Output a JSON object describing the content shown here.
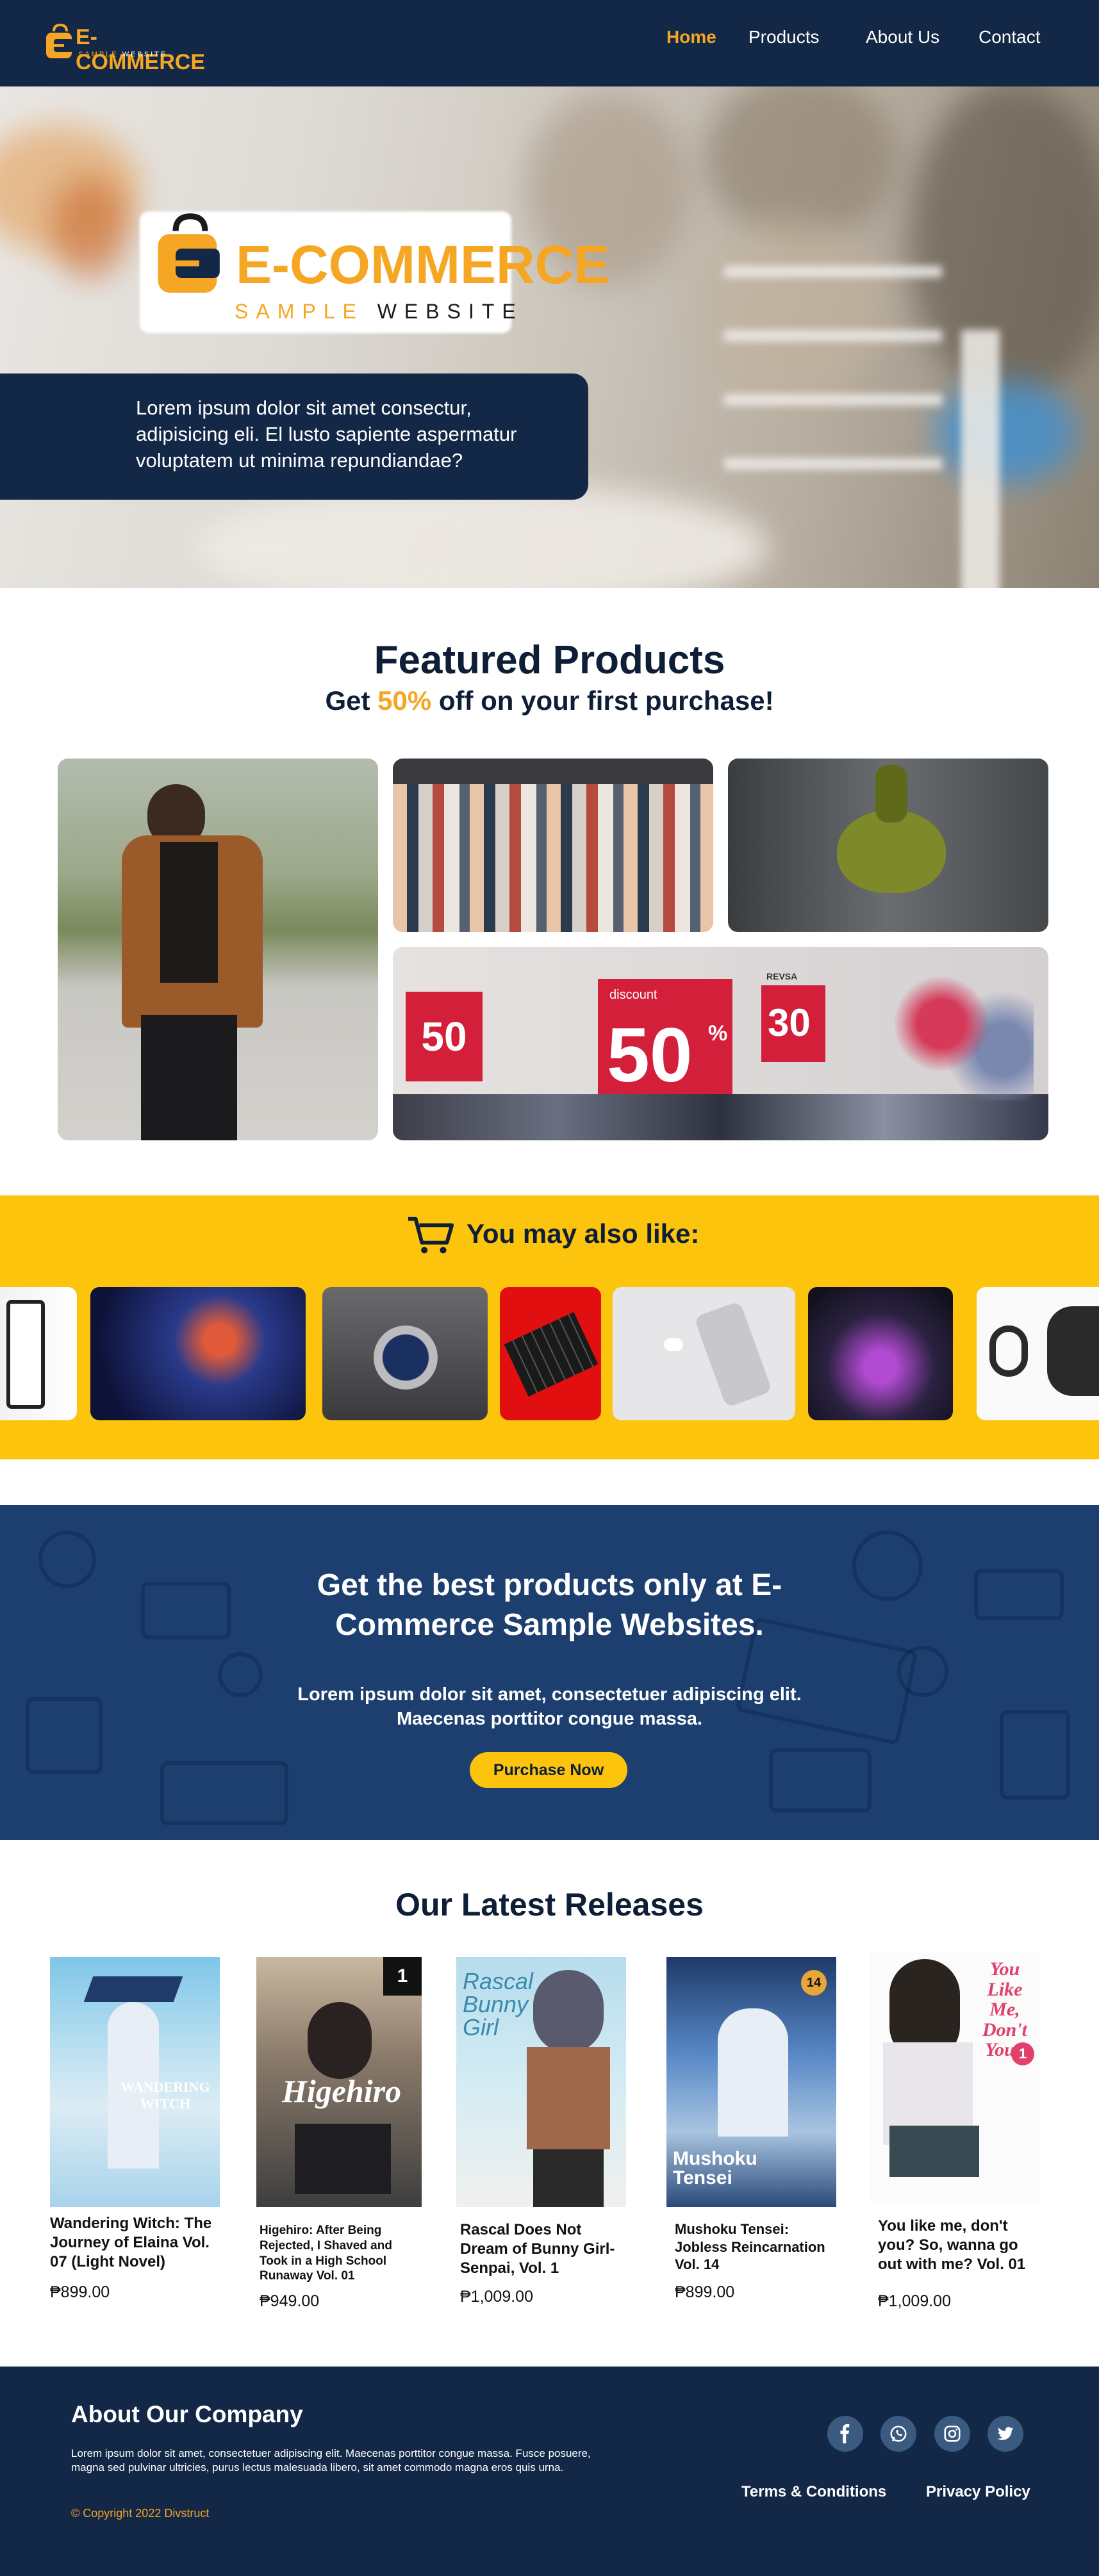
{
  "brand": {
    "name": "E-COMMERCE",
    "tagline_a": "SAMPLE",
    "tagline_b": "WEBSITE"
  },
  "nav": {
    "home": "Home",
    "products": "Products",
    "about": "About Us",
    "contact": "Contact"
  },
  "hero": {
    "text": "Lorem ipsum dolor sit amet consectur, adipisicing eli. El lusto sapiente aspermatur voluptatem ut minima repundiandae?"
  },
  "featured": {
    "title": "Featured Products",
    "sub_pre": "Get ",
    "sub_pct": "50%",
    "sub_post": " off on your first purchase!",
    "sale_tags": [
      "50",
      "discount",
      "50",
      "%",
      "30",
      "REVSA"
    ]
  },
  "also_like": {
    "title": "You may also like:"
  },
  "promo": {
    "title_l1": "Get the best products only at E-",
    "title_l2": "Commerce Sample Websites.",
    "text_l1": "Lorem ipsum dolor sit amet, consectetuer adipiscing elit.",
    "text_l2": "Maecenas porttitor congue massa.",
    "button": "Purchase Now"
  },
  "releases": {
    "title": "Our Latest Releases",
    "books": [
      {
        "title": "Wandering Witch: The Journey of Elaina Vol. 07 (Light Novel)",
        "price": "₱899.00",
        "cover_text": "WANDERING WITCH"
      },
      {
        "title": "Higehiro: After Being Rejected, I Shaved and Took in a High School Runaway Vol. 01",
        "price": "₱949.00",
        "cover_text": "Higehiro",
        "cover_vol": "1"
      },
      {
        "title": "Rascal Does Not Dream of Bunny Girl-Senpai, Vol. 1",
        "price": "₱1,009.00",
        "cover_text": "Rascal Bunny Girl"
      },
      {
        "title": "Mushoku Tensei: Jobless Reincarnation Vol. 14",
        "price": "₱899.00",
        "cover_text": "Mushoku Tensei",
        "cover_vol": "14"
      },
      {
        "title": "You like me, don't you? So, wanna go out with me? Vol. 01",
        "price": "₱1,009.00",
        "cover_text": "You Like Me, Don't You?",
        "cover_vol": "1"
      }
    ]
  },
  "footer": {
    "title": "About Our Company",
    "text": "Lorem ipsum dolor sit amet, consectetuer adipiscing elit. Maecenas porttitor congue massa. Fusce posuere, magna sed pulvinar ultricies, purus lectus malesuada libero, sit amet commodo magna eros quis urna.",
    "copyright": "©  Copyright 2022 Divstruct",
    "terms": "Terms & Conditions",
    "privacy": "Privacy Policy"
  },
  "colors": {
    "navy": "#132847",
    "orange": "#f5a623",
    "yellow": "#fcc40c",
    "promo_blue": "#1c3f70"
  }
}
